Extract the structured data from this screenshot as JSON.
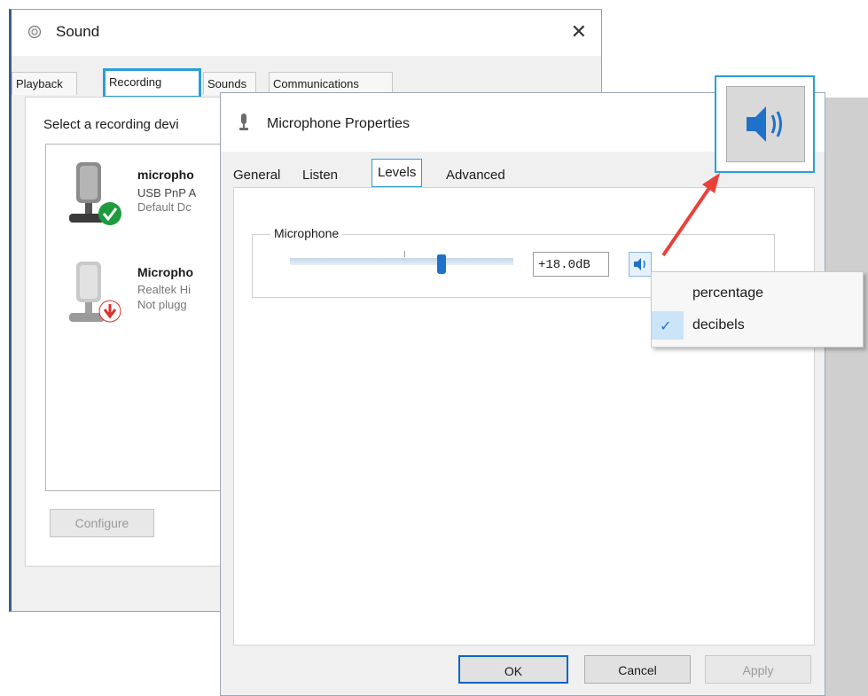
{
  "sound_window": {
    "title": "Sound",
    "close_glyph": "✕",
    "tabs": [
      {
        "label": "Playback"
      },
      {
        "label": "Recording"
      },
      {
        "label": "Sounds"
      },
      {
        "label": "Communications"
      }
    ],
    "selected_tab": "Recording",
    "instructions": "Select a recording devi",
    "devices": [
      {
        "name": "micropho",
        "line1": "USB PnP A",
        "line2": "Default Dc",
        "status": "default",
        "status_color": "#1e9b3c"
      },
      {
        "name": "Micropho",
        "line1": "Realtek Hi",
        "line2": "Not plugg",
        "status": "unplugged",
        "status_color": "#d9312b"
      }
    ],
    "configure_label": "Configure"
  },
  "properties_window": {
    "title": "Microphone Properties",
    "tabs": [
      {
        "label": "General"
      },
      {
        "label": "Listen"
      },
      {
        "label": "Levels"
      },
      {
        "label": "Advanced"
      }
    ],
    "selected_tab": "Levels",
    "group_label": "Microphone",
    "slider_level": 0.68,
    "db_value": "+18.0dB",
    "buttons": {
      "ok": "OK",
      "cancel": "Cancel",
      "apply": "Apply"
    }
  },
  "unit_menu": {
    "items": [
      {
        "label": "percentage",
        "checked": false
      },
      {
        "label": "decibels",
        "checked": true
      }
    ],
    "check_glyph": "✓"
  },
  "icons": {
    "speaker_icon": "speaker-icon",
    "microphone_icon": "microphone-icon",
    "shield_icon": "sound-icon"
  },
  "colors": {
    "highlight": "#2a9fd6",
    "arrow": "#e8413c",
    "speaker_blue": "#1f72c8"
  }
}
